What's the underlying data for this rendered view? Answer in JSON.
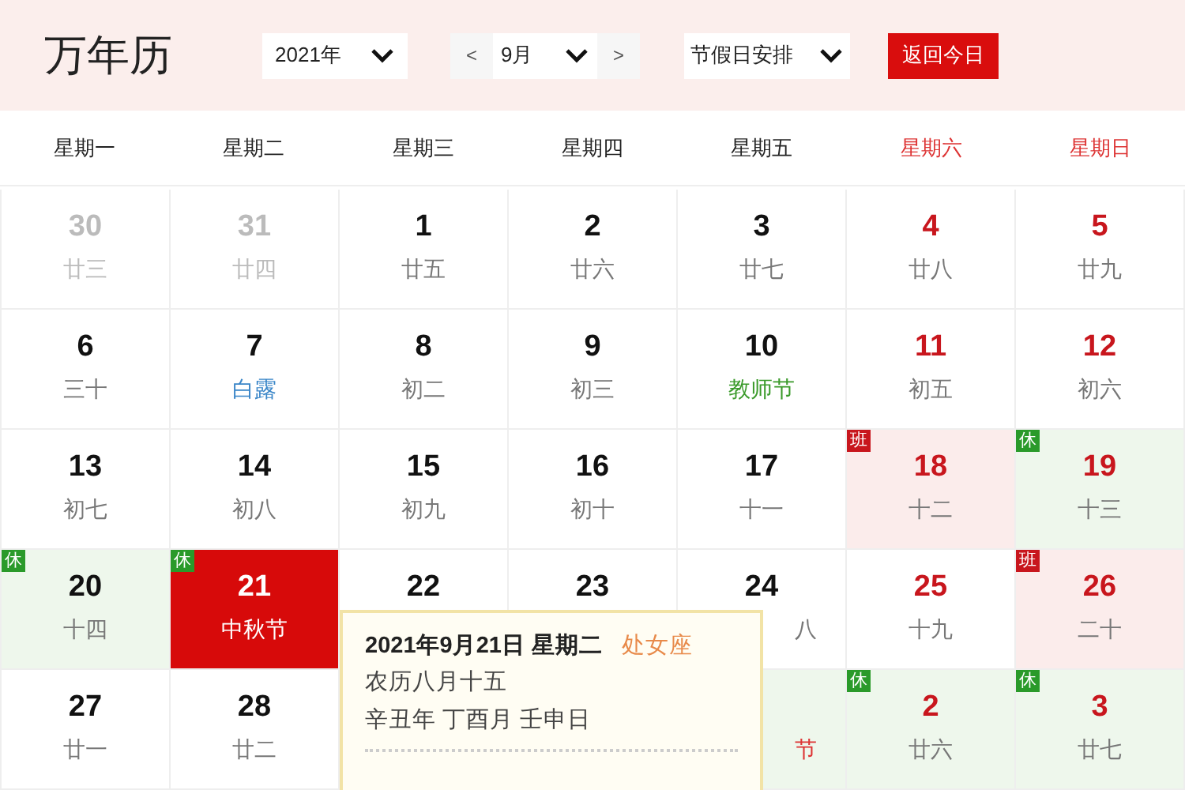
{
  "header": {
    "title": "万年历",
    "year_select": "2021年",
    "prev": "<",
    "month_select": "9月",
    "next": ">",
    "holiday_select": "节假日安排",
    "today_button": "返回今日"
  },
  "weekdays": [
    {
      "label": "星期一",
      "weekend": false
    },
    {
      "label": "星期二",
      "weekend": false
    },
    {
      "label": "星期三",
      "weekend": false
    },
    {
      "label": "星期四",
      "weekend": false
    },
    {
      "label": "星期五",
      "weekend": false
    },
    {
      "label": "星期六",
      "weekend": true
    },
    {
      "label": "星期日",
      "weekend": true
    }
  ],
  "weeks": [
    [
      {
        "day": "30",
        "lunar": "廿三",
        "muted": true,
        "selected": false
      },
      {
        "day": "31",
        "lunar": "廿四",
        "muted": true,
        "selected": false
      },
      {
        "day": "1",
        "lunar": "廿五",
        "muted": false,
        "selected": false
      },
      {
        "day": "2",
        "lunar": "廿六",
        "muted": false,
        "selected": false
      },
      {
        "day": "3",
        "lunar": "廿七",
        "muted": false,
        "selected": false
      },
      {
        "day": "4",
        "lunar": "廿八",
        "muted": false,
        "selected": false
      },
      {
        "day": "5",
        "lunar": "廿九",
        "muted": false,
        "selected": false
      }
    ],
    [
      {
        "day": "6",
        "lunar": "三十",
        "muted": false,
        "selected": false
      },
      {
        "day": "7",
        "lunar": "白露",
        "term": true,
        "muted": false,
        "selected": false
      },
      {
        "day": "8",
        "lunar": "初二",
        "muted": false,
        "selected": false
      },
      {
        "day": "9",
        "lunar": "初三",
        "muted": false,
        "selected": false
      },
      {
        "day": "10",
        "lunar": "教师节",
        "festival": true,
        "muted": false,
        "selected": false
      },
      {
        "day": "11",
        "lunar": "初五",
        "muted": false,
        "selected": false
      },
      {
        "day": "12",
        "lunar": "初六",
        "muted": false,
        "selected": false
      }
    ],
    [
      {
        "day": "13",
        "lunar": "初七",
        "muted": false,
        "selected": false
      },
      {
        "day": "14",
        "lunar": "初八",
        "muted": false,
        "selected": false
      },
      {
        "day": "15",
        "lunar": "初九",
        "muted": false,
        "selected": false
      },
      {
        "day": "16",
        "lunar": "初十",
        "muted": false,
        "selected": false
      },
      {
        "day": "17",
        "lunar": "十一",
        "muted": false,
        "selected": false
      },
      {
        "day": "18",
        "lunar": "十二",
        "workday": true,
        "badge": "班",
        "muted": false,
        "selected": false
      },
      {
        "day": "19",
        "lunar": "十三",
        "holiday": true,
        "badge": "休",
        "muted": false,
        "selected": false
      }
    ],
    [
      {
        "day": "20",
        "lunar": "十四",
        "holiday": true,
        "badge": "休",
        "muted": false,
        "selected": false
      },
      {
        "day": "21",
        "lunar": "中秋节",
        "festival": true,
        "holiday": true,
        "badge": "休",
        "muted": false,
        "selected": true
      },
      {
        "day": "22",
        "muted": false,
        "selected": false
      },
      {
        "day": "23",
        "muted": false,
        "selected": false
      },
      {
        "day": "24",
        "lunar": "八",
        "clipped_left": true,
        "muted": false,
        "selected": false
      },
      {
        "day": "25",
        "lunar": "十九",
        "muted": false,
        "selected": false
      },
      {
        "day": "26",
        "lunar": "二十",
        "workday": true,
        "badge": "班",
        "muted": false,
        "selected": false
      }
    ],
    [
      {
        "day": "27",
        "lunar": "廿一",
        "muted": false,
        "selected": false
      },
      {
        "day": "28",
        "lunar": "廿二",
        "muted": false,
        "selected": false
      },
      {
        "lunar": "节",
        "festival": true,
        "holiday": true,
        "clipped_left": true
      },
      {
        "day": "2",
        "lunar": "廿六",
        "holiday": true,
        "badge": "休",
        "muted": false,
        "selected": false
      },
      {
        "day": "3",
        "lunar": "廿七",
        "holiday": true,
        "badge": "休",
        "muted": false,
        "selected": false
      }
    ]
  ],
  "tooltip": {
    "date": "2021年9月21日 星期二",
    "zodiac": "处女座",
    "lunar_date": "农历八月十五",
    "ganzhi": "辛丑年 丁酉月 壬申日"
  }
}
